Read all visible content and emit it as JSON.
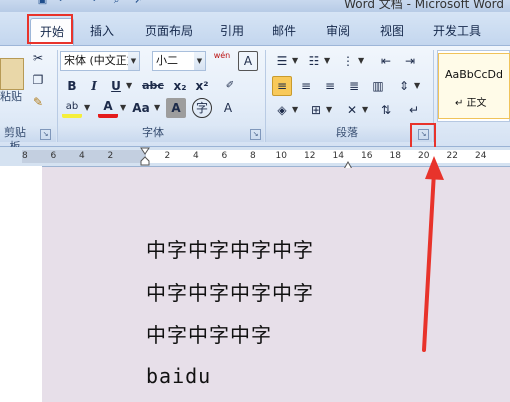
{
  "window": {
    "title": "Word 文档 - Microsoft Word"
  },
  "tabs": [
    {
      "label": "开始",
      "active": true
    },
    {
      "label": "插入"
    },
    {
      "label": "页面布局"
    },
    {
      "label": "引用"
    },
    {
      "label": "邮件"
    },
    {
      "label": "审阅"
    },
    {
      "label": "视图"
    },
    {
      "label": "开发工具"
    }
  ],
  "clipboard": {
    "paste_label": "粘贴",
    "group_label": "剪贴板"
  },
  "font": {
    "font_name": "宋体 (中文正文)",
    "font_size": "小二",
    "phonetic_label": "wén",
    "group_label": "字体",
    "bold": "B",
    "italic": "I",
    "underline": "U",
    "strike": "abc",
    "subscript": "x₂",
    "superscript": "x²",
    "grow_case": "Aa",
    "char_shade": "A",
    "font_color": "A",
    "highlight": "ab"
  },
  "paragraph": {
    "group_label": "段落"
  },
  "styles": {
    "preview_text": "AaBbCcDd",
    "style_name": "↵ 正文"
  },
  "ruler": {
    "ticks": [
      "8",
      "6",
      "4",
      "2",
      "",
      "2",
      "4",
      "6",
      "8",
      "10",
      "12",
      "14",
      "16",
      "18",
      "20",
      "22",
      "24"
    ]
  },
  "document": {
    "lines": [
      "中字中字中字中字",
      "中字中字中字中字",
      "中字中字中字",
      "baidu"
    ]
  },
  "colors": {
    "accent_red": "#e8332b",
    "font_color_red": "#e41b1b",
    "highlight_yellow": "#f5ef3b"
  }
}
